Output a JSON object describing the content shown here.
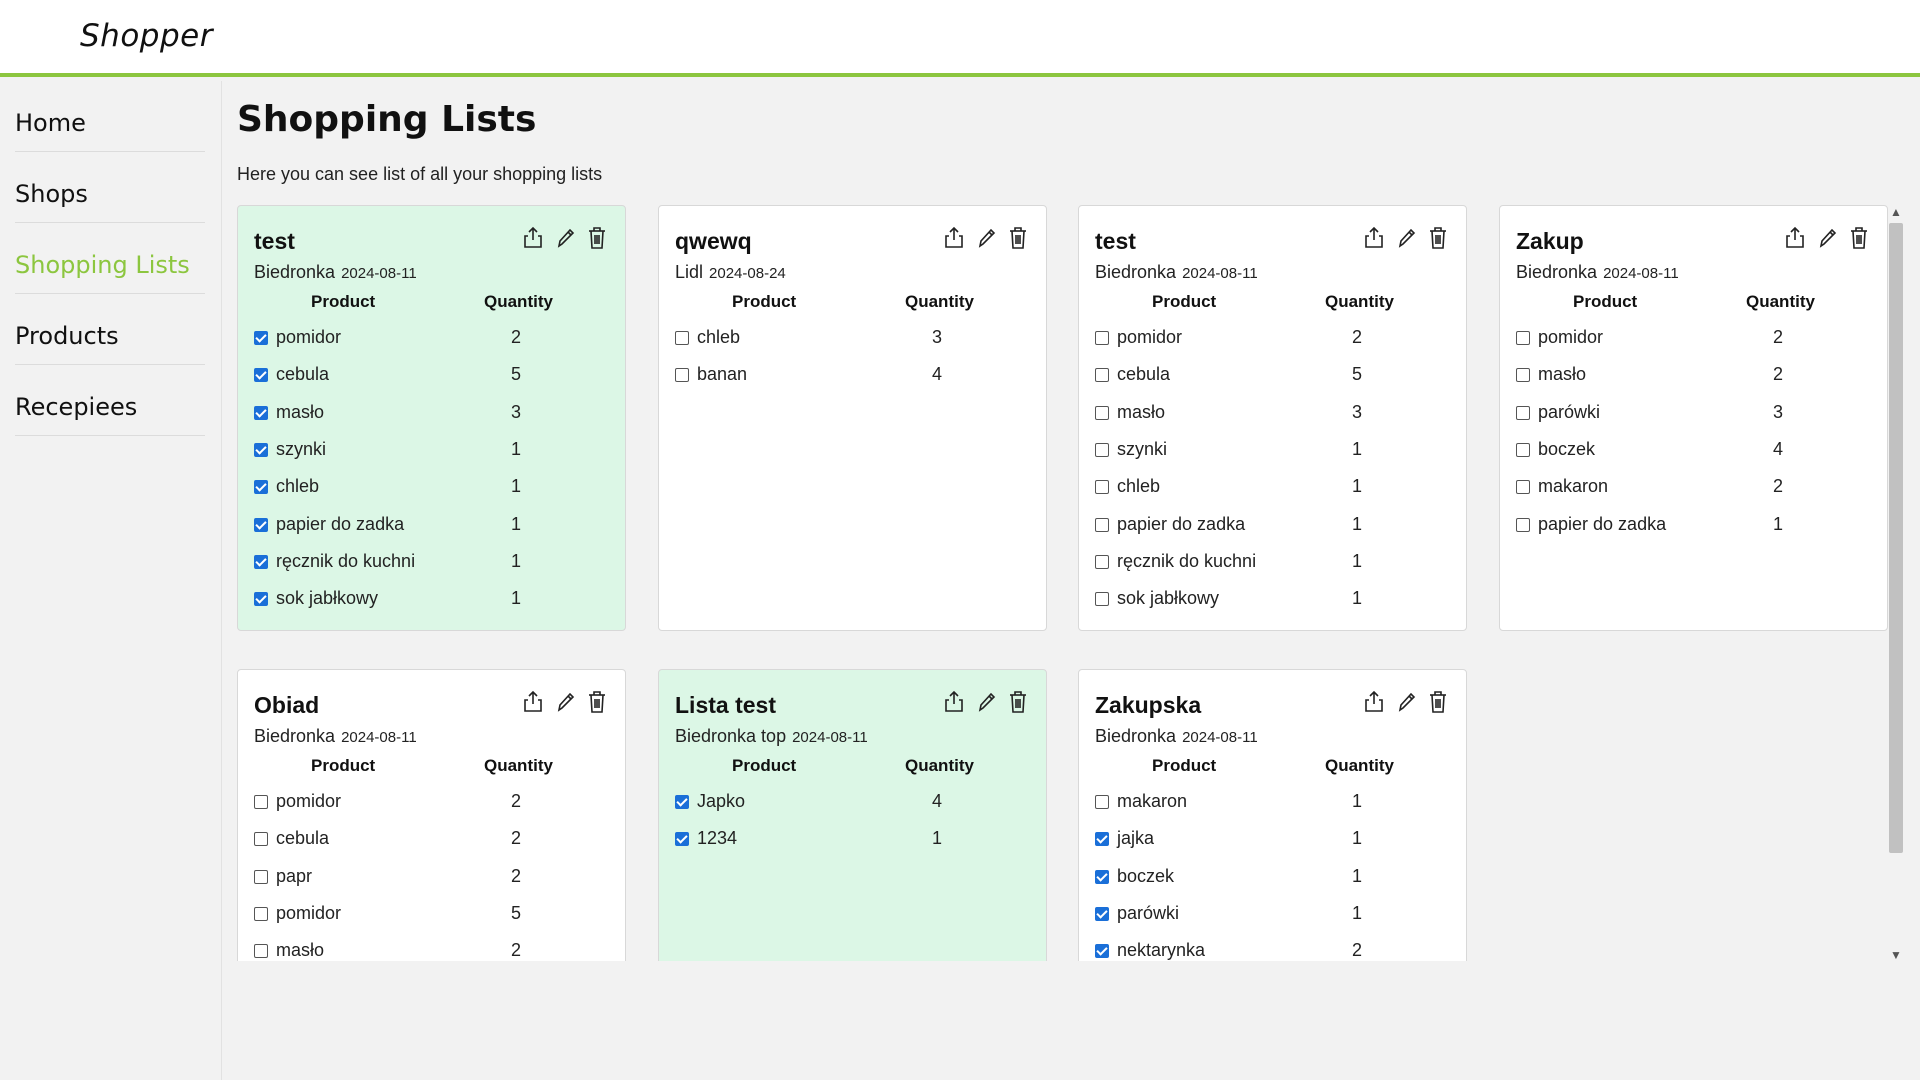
{
  "app": {
    "title": "Shopper"
  },
  "nav": [
    {
      "label": "Home",
      "active": false
    },
    {
      "label": "Shops",
      "active": false
    },
    {
      "label": "Shopping Lists",
      "active": true
    },
    {
      "label": "Products",
      "active": false
    },
    {
      "label": "Recepiees",
      "active": false
    }
  ],
  "page": {
    "title": "Shopping Lists",
    "subtitle": "Here you can see list of all your shopping lists"
  },
  "table_headers": {
    "product": "Product",
    "quantity": "Quantity"
  },
  "colors": {
    "accent": "#8cc63f",
    "completed_card": "#dcf7e6",
    "checkbox": "#1a6fd8"
  },
  "icons": {
    "share": "share-icon",
    "edit": "pencil-icon",
    "delete": "trash-icon"
  },
  "lists": [
    {
      "name": "test",
      "shop": "Biedronka",
      "date": "2024-08-11",
      "completed": true,
      "items": [
        {
          "product": "pomidor",
          "qty": "2",
          "checked": true
        },
        {
          "product": "cebula",
          "qty": "5",
          "checked": true
        },
        {
          "product": "masło",
          "qty": "3",
          "checked": true
        },
        {
          "product": "szynki",
          "qty": "1",
          "checked": true
        },
        {
          "product": "chleb",
          "qty": "1",
          "checked": true
        },
        {
          "product": "papier do zadka",
          "qty": "1",
          "checked": true
        },
        {
          "product": "ręcznik do kuchni",
          "qty": "1",
          "checked": true
        },
        {
          "product": "sok jabłkowy",
          "qty": "1",
          "checked": true
        }
      ]
    },
    {
      "name": "qwewq",
      "shop": "Lidl",
      "date": "2024-08-24",
      "completed": false,
      "items": [
        {
          "product": "chleb",
          "qty": "3",
          "checked": false
        },
        {
          "product": "banan",
          "qty": "4",
          "checked": false
        }
      ]
    },
    {
      "name": "test",
      "shop": "Biedronka",
      "date": "2024-08-11",
      "completed": false,
      "items": [
        {
          "product": "pomidor",
          "qty": "2",
          "checked": false
        },
        {
          "product": "cebula",
          "qty": "5",
          "checked": false
        },
        {
          "product": "masło",
          "qty": "3",
          "checked": false
        },
        {
          "product": "szynki",
          "qty": "1",
          "checked": false
        },
        {
          "product": "chleb",
          "qty": "1",
          "checked": false
        },
        {
          "product": "papier do zadka",
          "qty": "1",
          "checked": false
        },
        {
          "product": "ręcznik do kuchni",
          "qty": "1",
          "checked": false
        },
        {
          "product": "sok jabłkowy",
          "qty": "1",
          "checked": false
        }
      ]
    },
    {
      "name": "Zakup",
      "shop": "Biedronka",
      "date": "2024-08-11",
      "completed": false,
      "items": [
        {
          "product": "pomidor",
          "qty": "2",
          "checked": false
        },
        {
          "product": "masło",
          "qty": "2",
          "checked": false
        },
        {
          "product": "parówki",
          "qty": "3",
          "checked": false
        },
        {
          "product": "boczek",
          "qty": "4",
          "checked": false
        },
        {
          "product": "makaron",
          "qty": "2",
          "checked": false
        },
        {
          "product": "papier do zadka",
          "qty": "1",
          "checked": false
        }
      ]
    },
    {
      "name": "Obiad",
      "shop": "Biedronka",
      "date": "2024-08-11",
      "completed": false,
      "items": [
        {
          "product": "pomidor",
          "qty": "2",
          "checked": false
        },
        {
          "product": "cebula",
          "qty": "2",
          "checked": false
        },
        {
          "product": "papr",
          "qty": "2",
          "checked": false
        },
        {
          "product": "pomidor",
          "qty": "5",
          "checked": false
        },
        {
          "product": "masło",
          "qty": "2",
          "checked": false
        }
      ]
    },
    {
      "name": "Lista test",
      "shop": "Biedronka top",
      "date": "2024-08-11",
      "completed": true,
      "items": [
        {
          "product": "Japko",
          "qty": "4",
          "checked": true
        },
        {
          "product": "1234",
          "qty": "1",
          "checked": true
        }
      ]
    },
    {
      "name": "Zakupska",
      "shop": "Biedronka",
      "date": "2024-08-11",
      "completed": false,
      "items": [
        {
          "product": "makaron",
          "qty": "1",
          "checked": false
        },
        {
          "product": "jajka",
          "qty": "1",
          "checked": true
        },
        {
          "product": "boczek",
          "qty": "1",
          "checked": true
        },
        {
          "product": "parówki",
          "qty": "1",
          "checked": true
        },
        {
          "product": "nektarynka",
          "qty": "2",
          "checked": true
        }
      ]
    }
  ]
}
